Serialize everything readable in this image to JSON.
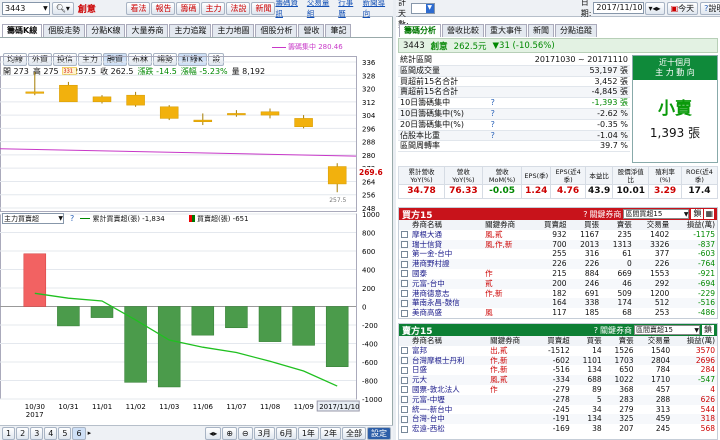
{
  "left": {
    "toolbar": {
      "symbol": "3443",
      "name": "創意",
      "buttons": [
        "看法",
        "報告",
        "籌碼",
        "主力",
        "法說",
        "新聞"
      ],
      "links": [
        "籌碼資訊",
        "交易量組",
        "行事曆",
        "新聞導向"
      ]
    },
    "tabs": [
      "籌碼K線",
      "個股走勢",
      "分點K線",
      "大量券商",
      "主力追蹤",
      "主力地圖",
      "個股分析",
      "營收",
      "筆記"
    ],
    "active_tab": "籌碼K線",
    "overlay_label": "籌碼集中 280.46",
    "chart_tabs": [
      "均線",
      "外資",
      "投信",
      "主力",
      "融資",
      "布林",
      "趨勢",
      "紅綠K",
      "設"
    ],
    "ohlc": {
      "open": "開 273",
      "high": "高 275",
      "low": "低 257.5",
      "close": "收 262.5",
      "chg_label": "漲跌",
      "chg": "-14.5",
      "pct_label": "漲幅",
      "pct": "-5.23%",
      "vol": "量 8,192"
    },
    "sub_select": "主力買賣超",
    "legend1": "累計買賣超(張) -1,834",
    "legend2": "買賣超(張) -651",
    "pages": [
      "1",
      "2",
      "3",
      "4",
      "5",
      "6"
    ],
    "ranges": [
      "3月",
      "6月",
      "1年",
      "2年",
      "全部",
      "設定"
    ]
  },
  "chart_data": [
    {
      "type": "candlestick",
      "categories": [
        "10/30",
        "10/31",
        "11/01",
        "11/02",
        "11/03",
        "11/06",
        "11/07",
        "11/08",
        "11/09",
        "11/10"
      ],
      "ohlc": [
        [
          318,
          330,
          316,
          318
        ],
        [
          322,
          324,
          312,
          312
        ],
        [
          315,
          316,
          311,
          312
        ],
        [
          316,
          318,
          309,
          310
        ],
        [
          309,
          310,
          301,
          302
        ],
        [
          300,
          305,
          298,
          301
        ],
        [
          305,
          307,
          303,
          305
        ],
        [
          306,
          308,
          302,
          304
        ],
        [
          302,
          304,
          296,
          297
        ],
        [
          273,
          275,
          257.5,
          262.5
        ]
      ],
      "ylim": [
        248,
        336
      ],
      "yticks": [
        248,
        256,
        264,
        272,
        280,
        288,
        296,
        304,
        312,
        320,
        328,
        336
      ],
      "last_price": "269.6",
      "min_label": "257.5",
      "max_label": "331"
    },
    {
      "type": "bar+line",
      "categories": [
        "10/30",
        "10/31",
        "11/01",
        "11/02",
        "11/03",
        "11/06",
        "11/07",
        "11/08",
        "11/09",
        "11/10"
      ],
      "x_label_year": "2017",
      "last_date": "2017/11/10",
      "bars": [
        {
          "value": 570,
          "color": "#e00"
        },
        {
          "value": -210,
          "color": "#070"
        },
        {
          "value": -120,
          "color": "#070"
        },
        {
          "value": -820,
          "color": "#070"
        },
        {
          "value": -870,
          "color": "#070"
        },
        {
          "value": -310,
          "color": "#070"
        },
        {
          "value": -230,
          "color": "#070"
        },
        {
          "value": -380,
          "color": "#070"
        },
        {
          "value": -420,
          "color": "#070"
        },
        {
          "value": -651,
          "color": "#070"
        }
      ],
      "line": [
        570,
        360,
        240,
        -580,
        -1450,
        -1760,
        -1990,
        -2370,
        -2790,
        -3440
      ],
      "ylim": [
        -1000,
        1000
      ],
      "yticks": [
        1000,
        800,
        600,
        400,
        200,
        0,
        -200,
        -400,
        -600,
        -800,
        -1000
      ]
    }
  ],
  "right": {
    "toolbar": {
      "label": "統計天數:",
      "days": "",
      "date_label": "日期:",
      "date": "2017/11/10",
      "today": "今天",
      "help": "說明"
    },
    "tabs": [
      "籌碼分析",
      "營收比較",
      "重大事件",
      "新聞",
      "分點追蹤"
    ],
    "stock": {
      "code": "3443",
      "name": "創意",
      "price": "262.5元",
      "chg": "▼31 (-10.56%)"
    },
    "stats": [
      {
        "label": "統計區間",
        "value": "20171030 ~ 20171110",
        "cls": ""
      },
      {
        "label": "區間成交量",
        "value": "53,197 張",
        "cls": ""
      },
      {
        "label": "買超前15名合計",
        "value": "3,452 張",
        "cls": ""
      },
      {
        "label": "賣超前15名合計",
        "value": "-4,845 張",
        "cls": ""
      },
      {
        "label": "10日籌碼集中",
        "value": "-1,393 張",
        "cls": "grn"
      },
      {
        "label": "10日籌碼集中(%)",
        "value": "-2.62 %",
        "cls": ""
      },
      {
        "label": "20日籌碼集中(%)",
        "value": "-0.35 %",
        "cls": ""
      },
      {
        "label": "佔股本比重",
        "value": "-1.04 %",
        "cls": ""
      },
      {
        "label": "區間周轉率",
        "value": "39.7 %",
        "cls": ""
      }
    ],
    "trend": {
      "head1": "近十個月",
      "head2": "主 力 動 向",
      "label": "小賣",
      "value": "1,393 張"
    },
    "fund_headers": [
      "累計營收YoY(%)",
      "營收YoY(%)",
      "營收MoM(%)",
      "EPS(季)",
      "EPS(近4季)",
      "本益比",
      "股價淨值比",
      "殖利率(%)",
      "ROE(近4季)"
    ],
    "fund_values": [
      "34.78",
      "76.33",
      "-0.05",
      "1.24",
      "4.76",
      "43.9",
      "10.01",
      "3.29",
      "17.4"
    ],
    "buy": {
      "title": "買方15",
      "filter_label": "關鍵券商",
      "filter": "區間買超15",
      "btn": "鎖",
      "headers": [
        "券商名稱",
        "關鍵券商",
        "買賣超",
        "買張",
        "賣張",
        "交易量",
        "損益(萬)"
      ],
      "rows": [
        [
          "摩根大通",
          "風,貳",
          "932",
          "1167",
          "235",
          "1402",
          "-1175"
        ],
        [
          "瑞士信貸",
          "風,作,新",
          "700",
          "2013",
          "1313",
          "3326",
          "-837"
        ],
        [
          "第一金-台中",
          "",
          "255",
          "316",
          "61",
          "377",
          "-603"
        ],
        [
          "港商野村證",
          "",
          "226",
          "226",
          "0",
          "226",
          "-764"
        ],
        [
          "國泰",
          "作",
          "215",
          "884",
          "669",
          "1553",
          "-921"
        ],
        [
          "元富-台中",
          "貳",
          "200",
          "246",
          "46",
          "292",
          "-694"
        ],
        [
          "港商德意志",
          "作,新",
          "182",
          "691",
          "509",
          "1200",
          "-229"
        ],
        [
          "華南永昌-鼓信",
          "",
          "164",
          "338",
          "174",
          "512",
          "-516"
        ],
        [
          "美商高盛",
          "風",
          "117",
          "185",
          "68",
          "253",
          "-486"
        ]
      ]
    },
    "sell": {
      "title": "賣方15",
      "filter_label": "關鍵券商",
      "filter": "區間賣超15",
      "btn": "鎖",
      "headers": [
        "券商名稱",
        "關鍵券商",
        "買賣超",
        "買張",
        "賣張",
        "交易量",
        "損益(萬)"
      ],
      "rows": [
        [
          "富邦",
          "出,貳",
          "-1512",
          "14",
          "1526",
          "1540",
          "3570"
        ],
        [
          "台灣摩根士丹利",
          "作,新",
          "-602",
          "1101",
          "1703",
          "2804",
          "2696"
        ],
        [
          "日盛",
          "作,新",
          "-516",
          "134",
          "650",
          "784",
          "284"
        ],
        [
          "元大",
          "風,貳",
          "-334",
          "688",
          "1022",
          "1710",
          "-547"
        ],
        [
          "國票-敦北法人",
          "作",
          "-279",
          "89",
          "368",
          "457",
          "4"
        ],
        [
          "元富-中壢",
          "",
          "-278",
          "5",
          "283",
          "288",
          "626"
        ],
        [
          "統一-新台中",
          "",
          "-245",
          "34",
          "279",
          "313",
          "544"
        ],
        [
          "台灣-台中",
          "",
          "-191",
          "134",
          "325",
          "459",
          "318"
        ],
        [
          "宏遠-西松",
          "",
          "-169",
          "38",
          "207",
          "245",
          "568"
        ]
      ]
    }
  }
}
